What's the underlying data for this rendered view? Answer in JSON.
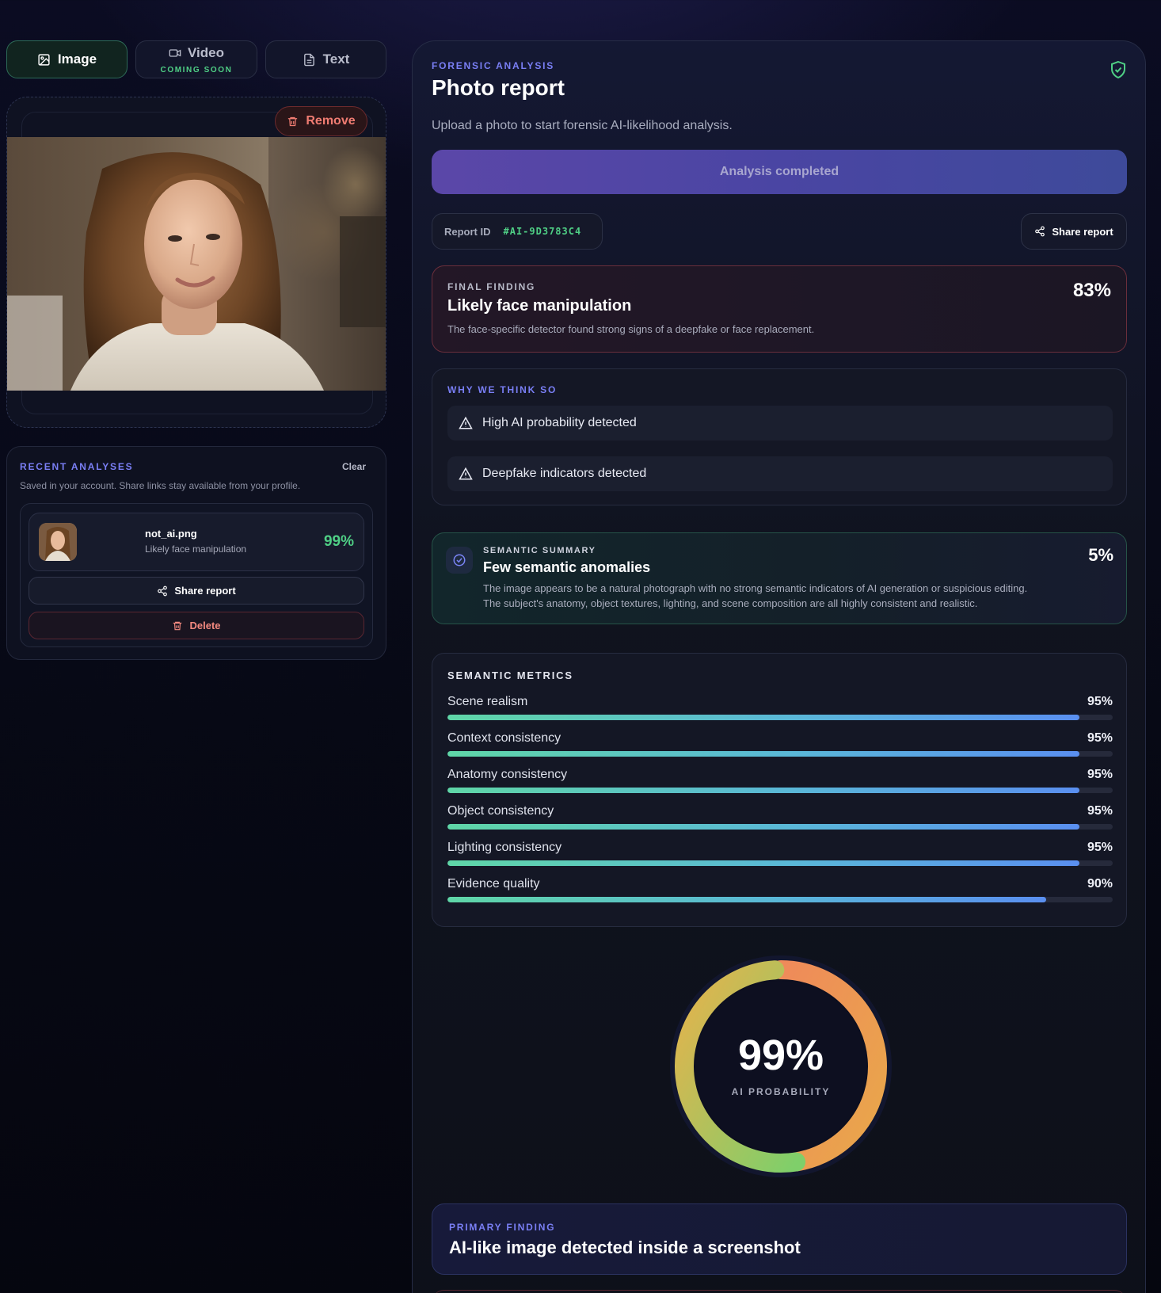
{
  "tabs": [
    {
      "label": "Image",
      "icon": "image-icon",
      "active": true
    },
    {
      "label": "Video",
      "icon": "video-icon",
      "badge": "COMING SOON"
    },
    {
      "label": "Text",
      "icon": "document-icon"
    }
  ],
  "upload": {
    "remove_label": "Remove"
  },
  "recent": {
    "title": "RECENT ANALYSES",
    "clear_label": "Clear",
    "subtitle": "Saved in your account. Share links stay available from your profile.",
    "items": [
      {
        "filename": "not_ai.png",
        "finding": "Likely face manipulation",
        "score": "99%",
        "share_label": "Share report",
        "delete_label": "Delete"
      }
    ]
  },
  "report": {
    "eyebrow": "FORENSIC ANALYSIS",
    "title": "Photo report",
    "subtitle": "Upload a photo to start forensic AI-likelihood analysis.",
    "status_button": "Analysis completed",
    "report_id_label": "Report ID",
    "report_id": "#AI-9D3783C4",
    "share_label": "Share report",
    "final_finding": {
      "label": "FINAL FINDING",
      "title": "Likely face manipulation",
      "description": "The face-specific detector found strong signs of a deepfake or face replacement.",
      "score": "83%"
    },
    "why": {
      "label": "WHY WE THINK SO",
      "items": [
        "High AI probability detected",
        "Deepfake indicators detected"
      ]
    },
    "semantic_summary": {
      "label": "SEMANTIC SUMMARY",
      "title": "Few semantic anomalies",
      "line1": "The image appears to be a natural photograph with no strong semantic indicators of AI generation or suspicious editing.",
      "line2": "The subject's anatomy, object textures, lighting, and scene composition are all highly consistent and realistic.",
      "score": "5%"
    },
    "metrics": {
      "label": "SEMANTIC METRICS",
      "items": [
        {
          "name": "Scene realism",
          "value": "95%",
          "fraction": 0.95
        },
        {
          "name": "Context consistency",
          "value": "95%",
          "fraction": 0.95
        },
        {
          "name": "Anatomy consistency",
          "value": "95%",
          "fraction": 0.95
        },
        {
          "name": "Object consistency",
          "value": "95%",
          "fraction": 0.95
        },
        {
          "name": "Lighting consistency",
          "value": "95%",
          "fraction": 0.95
        },
        {
          "name": "Evidence quality",
          "value": "90%",
          "fraction": 0.9
        }
      ]
    },
    "gauge": {
      "value": "99%",
      "label": "AI PROBABILITY",
      "fraction": 0.99
    },
    "primary_finding": {
      "label": "PRIMARY FINDING",
      "title": "AI-like image detected inside a screenshot"
    }
  },
  "colors": {
    "accent_purple": "#7a7ff5",
    "accent_green": "#4fcf85",
    "danger": "#f07c72"
  }
}
